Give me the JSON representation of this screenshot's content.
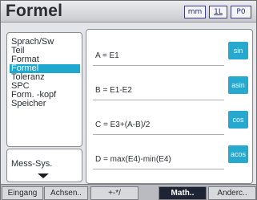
{
  "title": "Formel",
  "header_buttons": {
    "mm": "mm",
    "unit": "1L",
    "p0": "P0"
  },
  "list": {
    "items": [
      {
        "label": "Sprach/Sw",
        "selected": false
      },
      {
        "label": "Teil",
        "selected": false
      },
      {
        "label": "Format",
        "selected": false
      },
      {
        "label": "Formel",
        "selected": true
      },
      {
        "label": "Toleranz",
        "selected": false
      },
      {
        "label": "SPC",
        "selected": false
      },
      {
        "label": "Form. -kopf",
        "selected": false
      },
      {
        "label": "Speicher",
        "selected": false
      }
    ],
    "mes_label": "Mess-Sys."
  },
  "formulas": [
    {
      "expr": "A = E1",
      "fn_label": "sin"
    },
    {
      "expr": "B = E1-E2",
      "fn_label": "asin"
    },
    {
      "expr": "C = E3+(A-B)/2",
      "fn_label": "cos"
    },
    {
      "expr": "D = max(E4)-min(E4)",
      "fn_label": "acos"
    }
  ],
  "tabs": [
    {
      "label": "Eingang",
      "active": false
    },
    {
      "label": "Achsen..",
      "active": false
    },
    {
      "label": "+-*/",
      "active": false
    },
    {
      "label": "Math..",
      "active": true
    },
    {
      "label": "Anderc..",
      "active": false
    }
  ],
  "colors": {
    "accent": "#1ea8cf",
    "active_tab": "#1e2433"
  }
}
